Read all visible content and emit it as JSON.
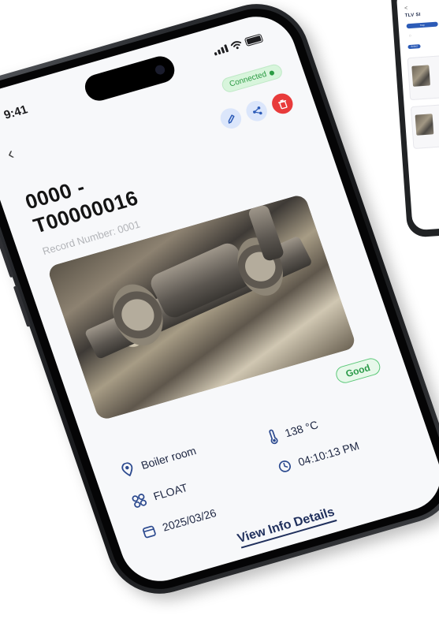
{
  "status_bar": {
    "time": "9:41"
  },
  "header": {
    "connection_status": "Connected",
    "record_id_line1": "0000 -",
    "record_id_line2": "T00000016",
    "record_number": "Record Number: 0001"
  },
  "condition": {
    "label": "Good"
  },
  "details": {
    "location": "Boiler room",
    "temperature": "138 °C",
    "trap_type": "FLOAT",
    "time": "04:10:13 PM",
    "date": "2025/03/26"
  },
  "actions": {
    "view_details": "View Info Details"
  },
  "background_phone": {
    "back": "<",
    "title": "TLV SI",
    "tab_label": "Trap",
    "chip_label": "Select"
  },
  "colors": {
    "accent_blue": "#2c5bb7",
    "connected_green": "#2c9b44",
    "delete_red": "#e83b3b",
    "good_green": "#5bc878",
    "text_navy": "#1c2541"
  },
  "icons": {
    "edit": "pencil-icon",
    "share": "share-icon",
    "delete": "trash-icon",
    "location": "location-pin-icon",
    "temperature": "thermometer-icon",
    "type": "float-trap-icon",
    "time": "clock-icon",
    "date": "calendar-icon"
  }
}
